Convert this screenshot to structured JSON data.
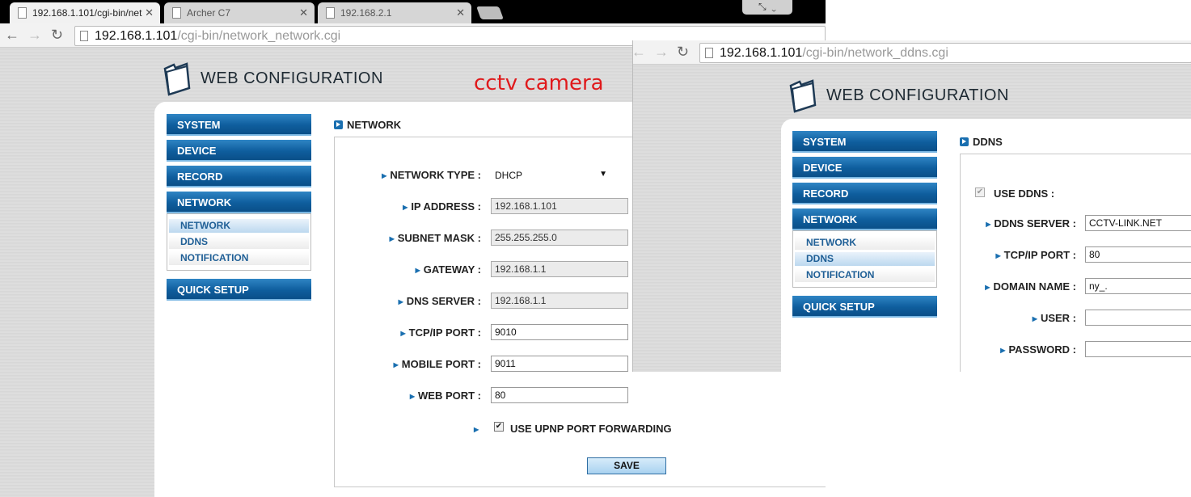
{
  "left_window": {
    "tabs": [
      {
        "title": "192.168.1.101/cgi-bin/net",
        "active": true
      },
      {
        "title": "Archer C7",
        "active": false
      },
      {
        "title": "192.168.2.1",
        "active": false
      }
    ],
    "url_host": "192.168.1.101",
    "url_path": "/cgi-bin/network_network.cgi",
    "logo_text": "WEB CONFIGURATION",
    "annotation": "cctv camera",
    "menu": {
      "system": "SYSTEM",
      "device": "DEVICE",
      "record": "RECORD",
      "network": "NETWORK",
      "sub_network": "NETWORK",
      "sub_ddns": "DDNS",
      "sub_notification": "NOTIFICATION",
      "quick_setup": "QUICK SETUP"
    },
    "section_title": "NETWORK",
    "form": {
      "network_type_label": "NETWORK TYPE :",
      "network_type_value": "DHCP",
      "ip_label": "IP ADDRESS :",
      "ip_value": "192.168.1.101",
      "subnet_label": "SUBNET MASK :",
      "subnet_value": "255.255.255.0",
      "gateway_label": "GATEWAY :",
      "gateway_value": "192.168.1.1",
      "dns_label": "DNS SERVER :",
      "dns_value": "192.168.1.1",
      "tcp_label": "TCP/IP PORT :",
      "tcp_value": "9010",
      "mobile_label": "MOBILE PORT :",
      "mobile_value": "9011",
      "web_label": "WEB PORT :",
      "web_value": "80",
      "upnp_label": "USE UPNP PORT FORWARDING",
      "upnp_checked": true,
      "save_label": "SAVE"
    }
  },
  "right_window": {
    "url_host": "192.168.1.101",
    "url_path": "/cgi-bin/network_ddns.cgi",
    "logo_text": "WEB CONFIGURATION",
    "menu": {
      "system": "SYSTEM",
      "device": "DEVICE",
      "record": "RECORD",
      "network": "NETWORK",
      "sub_network": "NETWORK",
      "sub_ddns": "DDNS",
      "sub_notification": "NOTIFICATION",
      "quick_setup": "QUICK SETUP"
    },
    "section_title": "DDNS",
    "form": {
      "use_ddns_label": "USE DDNS :",
      "use_ddns_checked": true,
      "server_label": "DDNS SERVER :",
      "server_value": "CCTV-LINK.NET",
      "tcp_label": "TCP/IP PORT :",
      "tcp_value": "80",
      "domain_label": "DOMAIN NAME :",
      "domain_value": "ny_.",
      "user_label": "USER :",
      "user_value": "",
      "password_label": "PASSWORD :",
      "password_value": ""
    }
  }
}
